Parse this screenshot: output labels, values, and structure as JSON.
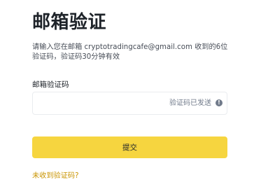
{
  "title": "邮箱验证",
  "description": "请输入您在邮箱 cryptotradingcafe@gmail.com 收到的6位验证码，验证码30分钟有效",
  "code_field": {
    "label": "邮箱验证码",
    "value": "",
    "placeholder": "",
    "status": "验证码已发送",
    "status_icon": "info-circle-icon"
  },
  "submit_label": "提交",
  "resend_link": "未收到验证码?",
  "colors": {
    "primary_button": "#f6d53f",
    "link": "#c99400",
    "title": "#1e2329"
  }
}
